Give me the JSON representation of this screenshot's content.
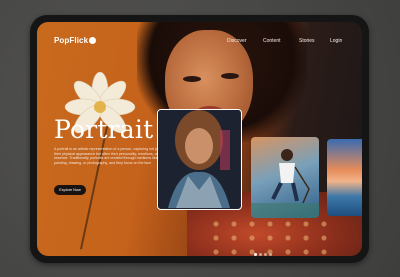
{
  "brand": {
    "name": "PopFlick"
  },
  "nav": {
    "items": [
      {
        "label": "Discover"
      },
      {
        "label": "Content"
      },
      {
        "label": "Stories"
      },
      {
        "label": "Login"
      }
    ]
  },
  "hero": {
    "title": "Portrait",
    "description": "A portrait is an artistic representation of a person, capturing not just their physical appearance but often their personality, emotions, and essence. Traditionally, portraits are created through mediums like painting, drawing, or photography, and they focus on the face",
    "button_label": "Explore Now"
  },
  "carousel": {
    "slides": [
      "portrait",
      "hockey",
      "seascape"
    ],
    "active_index": 0,
    "dot_count": 4
  },
  "colors": {
    "accent": "#c86a1e",
    "button": "#181210",
    "text": "#ffffff"
  }
}
